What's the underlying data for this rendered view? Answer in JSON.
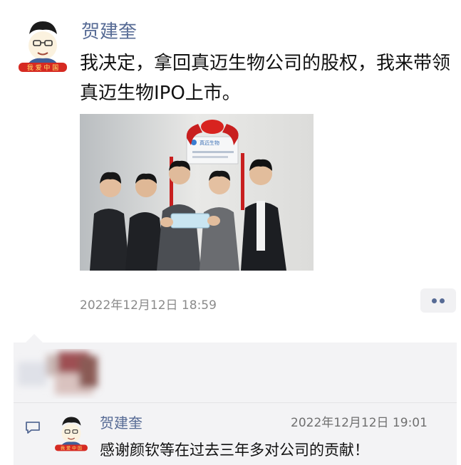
{
  "post": {
    "author": "贺建奎",
    "text": "我决定，拿回真迈生物公司的股权，我来带领真迈生物IPO上市。",
    "avatar_caption": "我 爱 中 国",
    "photo_sign_text": "真迈生物",
    "timestamp": "2022年12月12日 18:59"
  },
  "comment": {
    "author": "贺建奎",
    "timestamp": "2022年12月12日 19:01",
    "text": "感谢颜钦等在过去三年多对公司的贡献！",
    "avatar_caption": "我 爱 中 国"
  },
  "icons": {
    "more": "more-dots-icon",
    "comment": "comment-bubble-icon"
  },
  "colors": {
    "link_blue": "#576b95",
    "panel_bg": "#f3f3f5",
    "text": "#111111",
    "meta_gray": "#8a8a8a"
  }
}
